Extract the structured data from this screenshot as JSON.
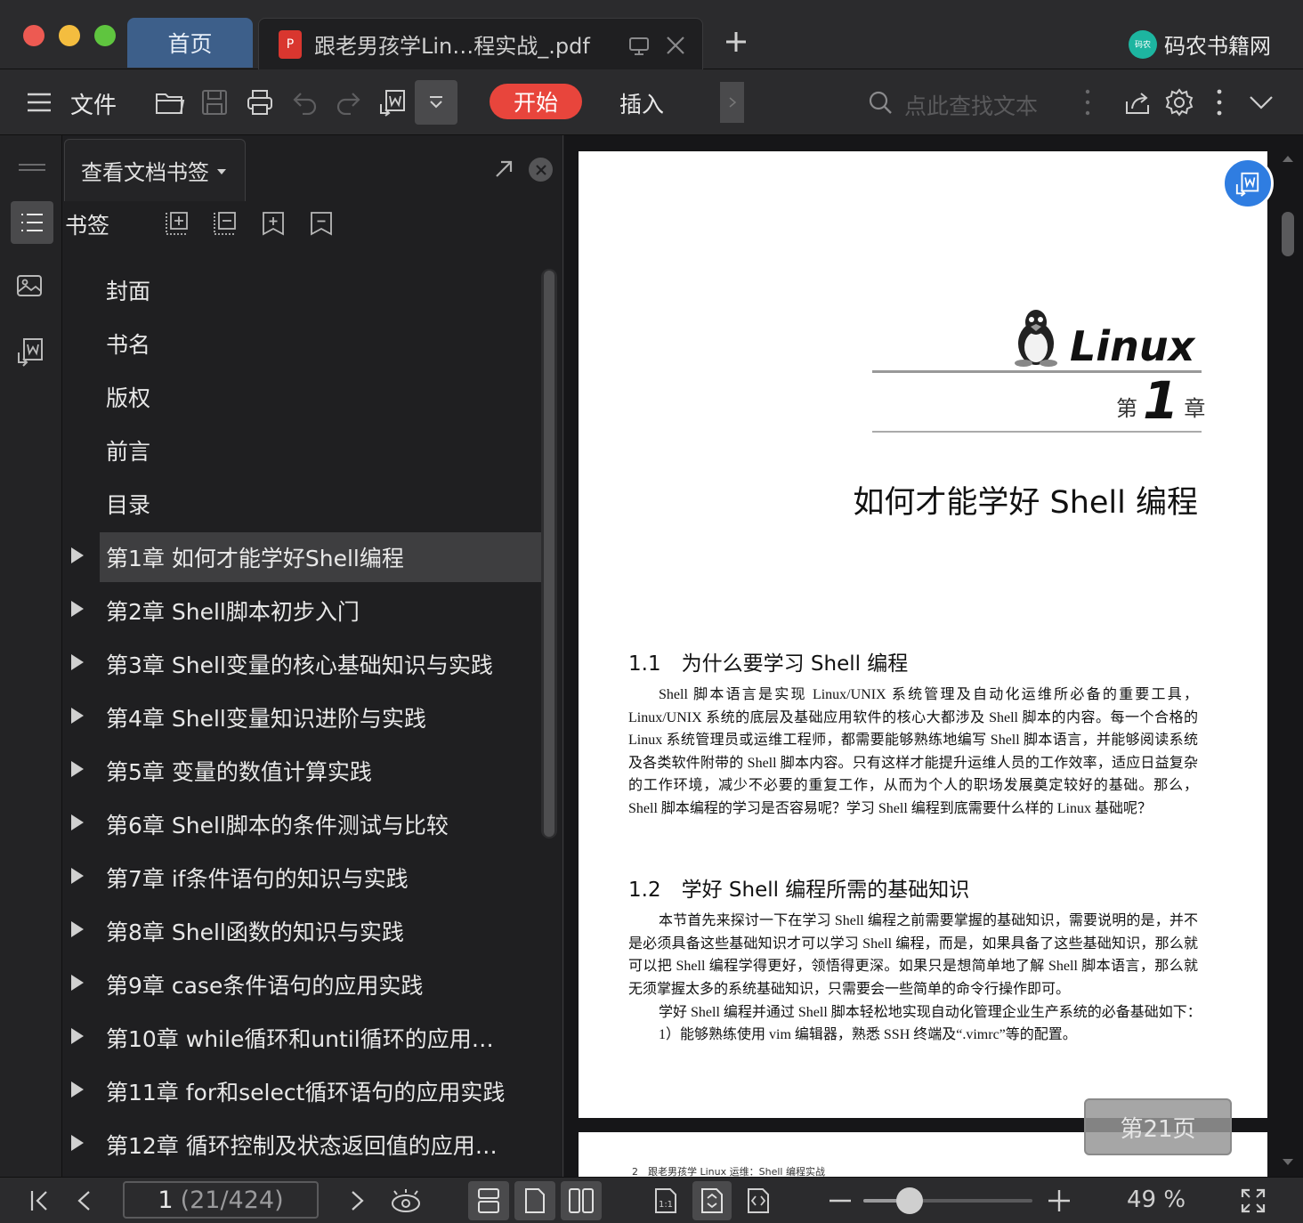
{
  "tabs": {
    "home_label": "首页",
    "doc_title": "跟老男孩学Lin…程实战_.pdf",
    "pdf_badge": "P"
  },
  "brand": {
    "name": "码农书籍网",
    "logo_text": "码农"
  },
  "toolbar": {
    "file_label": "文件",
    "start_label": "开始",
    "insert_label": "插入",
    "search_placeholder": "点此查找文本"
  },
  "panel": {
    "view_bookmarks_label": "查看文档书签",
    "bookmarks_heading": "书签",
    "items": [
      {
        "label": "封面",
        "has_children": false
      },
      {
        "label": "书名",
        "has_children": false
      },
      {
        "label": "版权",
        "has_children": false
      },
      {
        "label": "前言",
        "has_children": false
      },
      {
        "label": "目录",
        "has_children": false
      },
      {
        "label": "第1章 如何才能学好Shell编程",
        "has_children": true,
        "selected": true
      },
      {
        "label": "第2章 Shell脚本初步入门",
        "has_children": true
      },
      {
        "label": "第3章 Shell变量的核心基础知识与实践",
        "has_children": true
      },
      {
        "label": "第4章 Shell变量知识进阶与实践",
        "has_children": true
      },
      {
        "label": "第5章 变量的数值计算实践",
        "has_children": true
      },
      {
        "label": "第6章 Shell脚本的条件测试与比较",
        "has_children": true
      },
      {
        "label": "第7章 if条件语句的知识与实践",
        "has_children": true
      },
      {
        "label": "第8章 Shell函数的知识与实践",
        "has_children": true
      },
      {
        "label": "第9章 case条件语句的应用实践",
        "has_children": true
      },
      {
        "label": "第10章 while循环和until循环的应用…",
        "has_children": true
      },
      {
        "label": "第11章 for和select循环语句的应用实践",
        "has_children": true
      },
      {
        "label": "第12章 循环控制及状态返回值的应用…",
        "has_children": true
      }
    ]
  },
  "document": {
    "linux_label": "Linux",
    "chapter_prefix": "第",
    "chapter_number": "1",
    "chapter_suffix": "章",
    "chapter_title": "如何才能学好 Shell 编程",
    "s1_heading": "1.1　为什么要学习 Shell 编程",
    "s1_para": "Shell 脚本语言是实现 Linux/UNIX 系统管理及自动化运维所必备的重要工具，Linux/UNIX 系统的底层及基础应用软件的核心大都涉及 Shell 脚本的内容。每一个合格的 Linux 系统管理员或运维工程师，都需要能够熟练地编写 Shell 脚本语言，并能够阅读系统及各类软件附带的 Shell 脚本内容。只有这样才能提升运维人员的工作效率，适应日益复杂的工作环境，减少不必要的重复工作，从而为个人的职场发展奠定较好的基础。那么，Shell 脚本编程的学习是否容易呢？学习 Shell 编程到底需要什么样的 Linux 基础呢？",
    "s2_heading": "1.2　学好 Shell 编程所需的基础知识",
    "s2_para1": "本节首先来探讨一下在学习 Shell 编程之前需要掌握的基础知识，需要说明的是，并不是必须具备这些基础知识才可以学习 Shell 编程，而是，如果具备了这些基础知识，那么就可以把 Shell 编程学得更好，领悟得更深。如果只是想简单地了解 Shell 脚本语言，那么就无须掌握太多的系统基础知识，只需要会一些简单的命令行操作即可。",
    "s2_para2": "学好 Shell 编程并通过 Shell 脚本轻松地实现自动化管理企业生产系统的必备基础如下：",
    "s2_item1": "1）能够熟练使用 vim 编辑器，熟悉 SSH 终端及“.vimrc”等的配置。",
    "page_badge": "第21页",
    "next_page_header": "2　跟老男孩学 Linux 运维：Shell 编程实战"
  },
  "status": {
    "page_input": "1",
    "page_total": "(21/424)",
    "zoom": "49 %",
    "zoom_level": 0.49
  },
  "colors": {
    "accent_red": "#e8453c",
    "home_tab": "#3d5f8a",
    "floating_button": "#2f7de1"
  }
}
